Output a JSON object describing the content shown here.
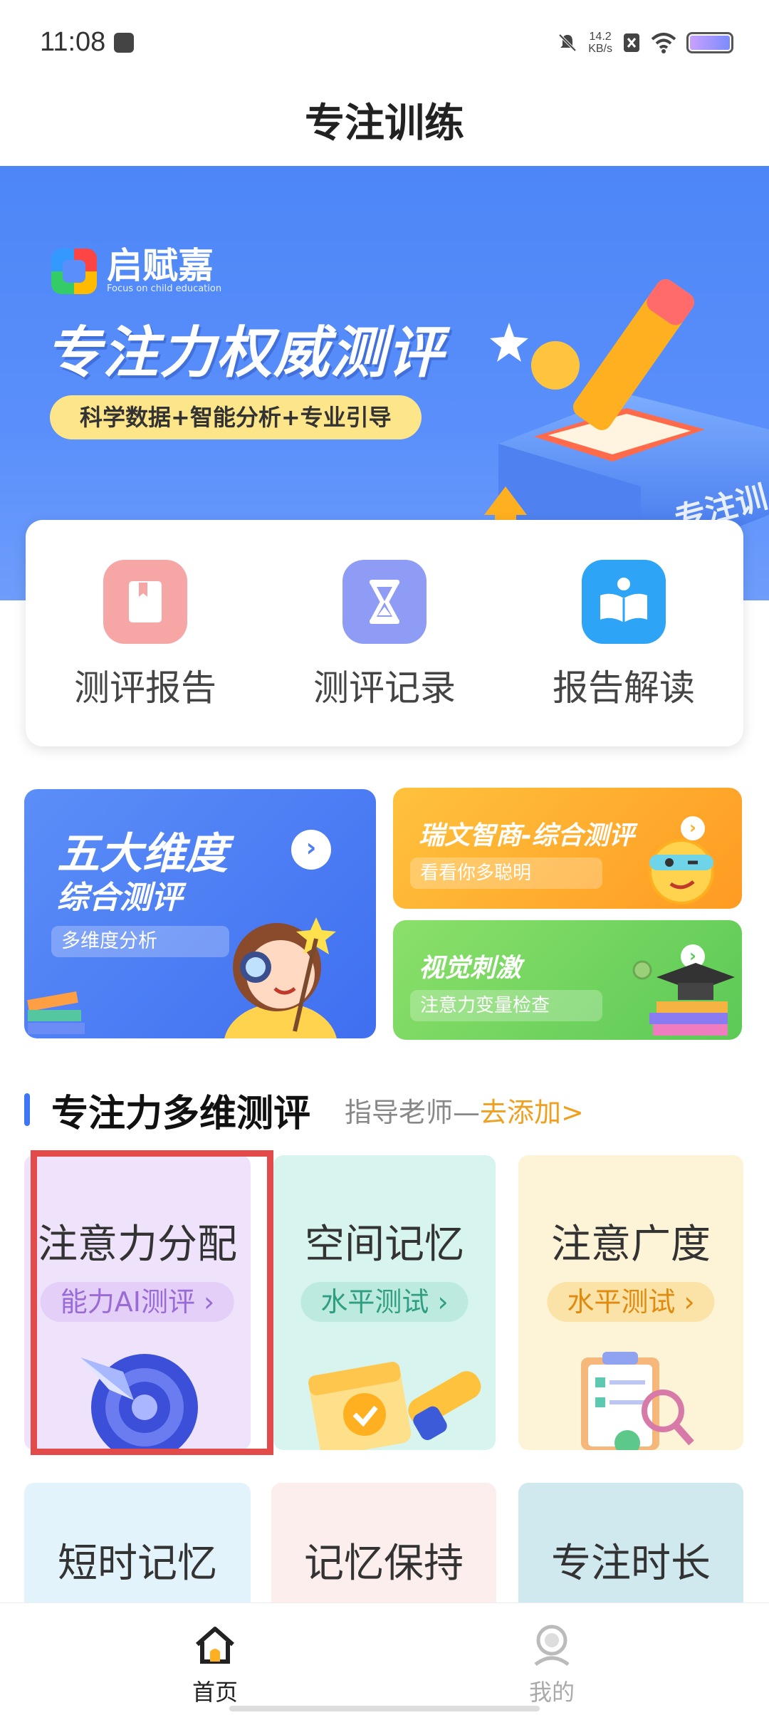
{
  "status_bar": {
    "time": "11:08",
    "net_speed": "14.2",
    "net_unit": "KB/s"
  },
  "header": {
    "title": "专注训练"
  },
  "banner": {
    "brand_name": "启赋嘉",
    "brand_slogan": "Focus on child education",
    "headline": "专注力权威测评",
    "tagline": "科学数据+智能分析+专业引导",
    "art_text": "专注训"
  },
  "shortcuts": [
    {
      "label": "测评报告",
      "icon": "book-icon",
      "color": "#f7a6a6"
    },
    {
      "label": "测评记录",
      "icon": "hourglass-icon",
      "color": "#8f9cf5"
    },
    {
      "label": "报告解读",
      "icon": "reading-icon",
      "color": "#2da4f5"
    }
  ],
  "features": {
    "big": {
      "title": "五大维度",
      "subtitle": "综合测评",
      "tag": "多维度分析"
    },
    "small": [
      {
        "title": "瑞文智商-综合测评",
        "subtitle": "看看你多聪明"
      },
      {
        "title": "视觉刺激",
        "subtitle": "注意力变量检查"
      }
    ]
  },
  "section": {
    "title": "专注力多维测评",
    "guide_prefix": "指导老师—",
    "guide_link": "去添加>"
  },
  "tests": [
    {
      "title": "注意力分配",
      "tag": "能力AI测评 ›",
      "bg": "#efe3fb",
      "tag_bg": "#e3cff7",
      "tag_color": "#9a6bd6"
    },
    {
      "title": "空间记忆",
      "tag": "水平测试 ›",
      "bg": "#d7f4ee",
      "tag_bg": "#bdeadf",
      "tag_color": "#2f9e82"
    },
    {
      "title": "注意广度",
      "tag": "水平测试 ›",
      "bg": "#fdf3d6",
      "tag_bg": "#fbe3a8",
      "tag_color": "#e08a10"
    },
    {
      "title": "短时记忆",
      "bg": "#e3f3fb"
    },
    {
      "title": "记忆保持",
      "bg": "#fdeeee"
    },
    {
      "title": "专注时长",
      "bg": "#cfe9ef"
    }
  ],
  "bottom_nav": [
    {
      "label": "首页",
      "active": true
    },
    {
      "label": "我的",
      "active": false
    }
  ]
}
